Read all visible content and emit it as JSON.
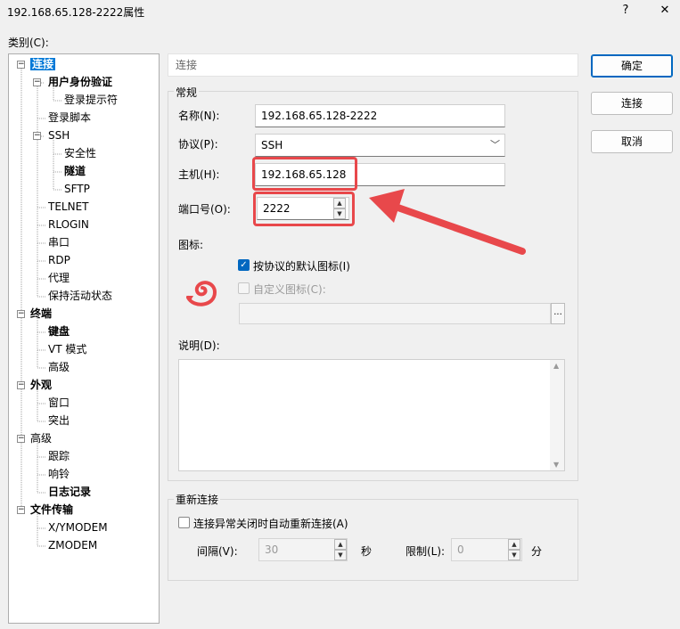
{
  "window": {
    "title": "192.168.65.128-2222属性",
    "help_button": "?",
    "close_button": "✕"
  },
  "category_label": "类别(C):",
  "tree": [
    {
      "label": "连接",
      "bold": true,
      "selected": true
    },
    {
      "label": "用户身份验证",
      "bold": true
    },
    {
      "label": "登录提示符"
    },
    {
      "label": "登录脚本"
    },
    {
      "label": "SSH"
    },
    {
      "label": "安全性"
    },
    {
      "label": "隧道",
      "bold": true
    },
    {
      "label": "SFTP"
    },
    {
      "label": "TELNET"
    },
    {
      "label": "RLOGIN"
    },
    {
      "label": "串口"
    },
    {
      "label": "RDP"
    },
    {
      "label": "代理"
    },
    {
      "label": "保持活动状态"
    },
    {
      "label": "终端",
      "bold": true
    },
    {
      "label": "键盘",
      "bold": true
    },
    {
      "label": "VT 模式"
    },
    {
      "label": "高级"
    },
    {
      "label": "外观",
      "bold": true
    },
    {
      "label": "窗口"
    },
    {
      "label": "突出"
    },
    {
      "label": "高级"
    },
    {
      "label": "跟踪"
    },
    {
      "label": "响铃"
    },
    {
      "label": "日志记录",
      "bold": true
    },
    {
      "label": "文件传输",
      "bold": true
    },
    {
      "label": "X/YMODEM"
    },
    {
      "label": "ZMODEM"
    }
  ],
  "header_text": "连接",
  "general": {
    "title": "常规",
    "name_label": "名称(N):",
    "name_value": "192.168.65.128-2222",
    "protocol_label": "协议(P):",
    "protocol_value": "SSH",
    "host_label": "主机(H):",
    "host_value": "192.168.65.128",
    "port_label": "端口号(O):",
    "port_value": "2222",
    "icon_label": "图标:",
    "default_icon_checkbox": "按协议的默认图标(I)",
    "custom_icon_checkbox": "自定义图标(C):",
    "browse_button": "...",
    "description_label": "说明(D):"
  },
  "reconnect": {
    "title": "重新连接",
    "auto_reconnect_checkbox": "连接异常关闭时自动重新连接(A)",
    "interval_label": "间隔(V):",
    "interval_value": "30",
    "seconds_label": "秒",
    "limit_label": "限制(L):",
    "limit_value": "0",
    "minutes_label": "分"
  },
  "buttons": {
    "ok": "确定",
    "connect": "连接",
    "cancel": "取消"
  },
  "colors": {
    "accent": "#0067c0",
    "highlight": "#e8484b",
    "selection": "#0078d7"
  }
}
